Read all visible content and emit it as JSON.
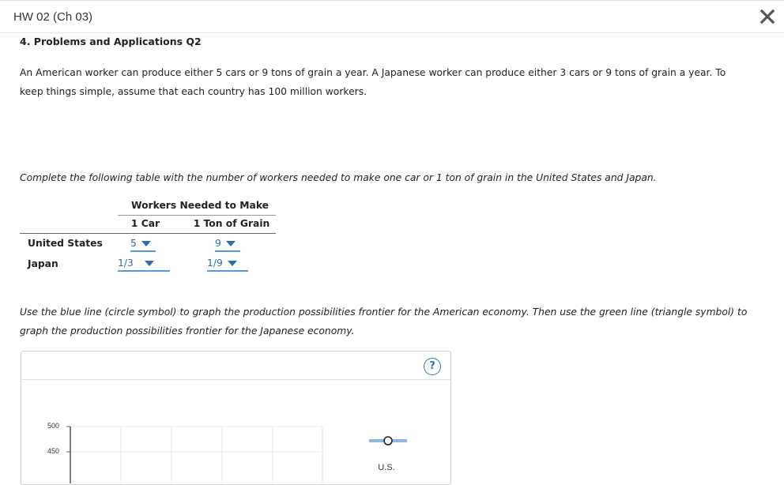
{
  "header": {
    "title": "HW 02 (Ch 03)",
    "close_icon": "close-icon"
  },
  "question": {
    "title": "4. Problems and Applications Q2",
    "intro_line1": "An American worker can produce either 5 cars or 9 tons of grain a year. A Japanese worker can produce either 3 cars or 9 tons of grain a year. To",
    "intro_line2": "keep things simple, assume that each country has 100 million workers.",
    "table_instruction": "Complete the following table with the number of workers needed to make one car or 1 ton of grain in the United States and Japan.",
    "graph_instruction_line1": "Use the blue line (circle symbol) to graph the production possibilities frontier for the American economy. Then use the green line (triangle symbol) to",
    "graph_instruction_line2": "graph the production possibilities frontier for the Japanese economy."
  },
  "table": {
    "group_header": "Workers Needed to Make",
    "col1": "1 Car",
    "col2": "1 Ton of Grain",
    "rows": [
      {
        "label": "United States",
        "car": "5",
        "grain": "9"
      },
      {
        "label": "Japan",
        "car": "1/3",
        "grain": "1/9"
      }
    ]
  },
  "graph": {
    "help_label": "?",
    "y_ticks": [
      "500",
      "450"
    ],
    "legend_us_label": "U.S.",
    "colors": {
      "us_line": "#8fb7db",
      "grid": "#e6e6e6",
      "accent": "#2a6fb0"
    }
  }
}
